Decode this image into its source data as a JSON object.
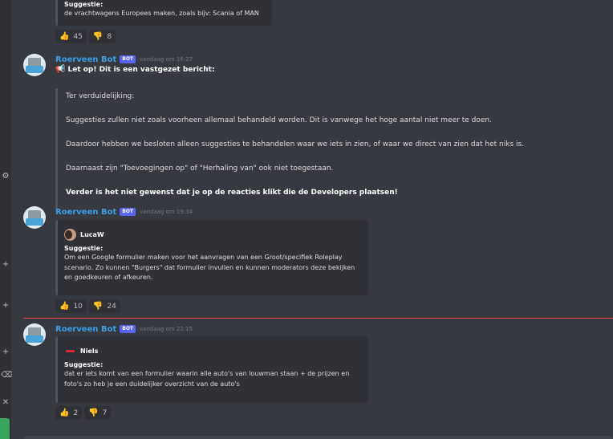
{
  "top_message": {
    "field_name": "Suggestie:",
    "field_value": "de vrachtwagens Europees maken, zoals bijv: Scania of MAN",
    "reactions": [
      {
        "emoji": "thumbs-up",
        "count": "45"
      },
      {
        "emoji": "thumbs-down",
        "count": "8"
      }
    ]
  },
  "messages": [
    {
      "username": "Roerveen Bot",
      "tag": "BOT",
      "timestamp": "vandaag om 16:27",
      "alert": "Let op! Dit is een vastgezet bericht:",
      "quote_lines": [
        "Ter verduidelijking:",
        "Suggesties zullen niet zoals voorheen allemaal behandeld worden. Dit is vanwege het hoge aantal niet meer te doen.",
        "Daardoor hebben we besloten alleen suggesties te behandelen waar we iets in zien, of waar we direct van zien dat het niks is.",
        "Daarnaast zijn \"Toevoegingen op\" of \"Herhaling van\" ook niet toegestaan.",
        "Verder is het niet gewenst dat je op de reacties klikt die de Developers plaatsen!"
      ]
    },
    {
      "username": "Roerveen Bot",
      "tag": "BOT",
      "timestamp": "vandaag om 19:34",
      "embed": {
        "author": "LucaW",
        "field_name": "Suggestie:",
        "field_value_lines": [
          "Om een Google formulier maken voor het aanvragen van een Groot/specifiek Roleplay",
          "scenario. Zo kunnen \"Burgers\" dat formulier invullen en kunnen moderators deze bekijken",
          "en goedkeuren of afkeuren."
        ]
      },
      "reactions": [
        {
          "emoji": "thumbs-up",
          "count": "10"
        },
        {
          "emoji": "thumbs-down",
          "count": "24"
        }
      ]
    },
    {
      "username": "Roerveen Bot",
      "tag": "BOT",
      "timestamp": "vandaag om 22:15",
      "embed": {
        "author": "Niels",
        "field_name": "Suggestie:",
        "field_value_lines": [
          "dat er iets komt van een formulier waarin alle auto's van louwman staan + de prijzen en",
          "foto's zo heb je een duidelijker overzicht van de auto's"
        ]
      },
      "reactions": [
        {
          "emoji": "thumbs-up",
          "count": "2"
        },
        {
          "emoji": "thumbs-down",
          "count": "7"
        }
      ]
    }
  ],
  "colors": {
    "background": "#36393f",
    "username": "#3e9ee6",
    "bot_tag": "#5865f2",
    "new_messages_divider": "#ed4245"
  }
}
